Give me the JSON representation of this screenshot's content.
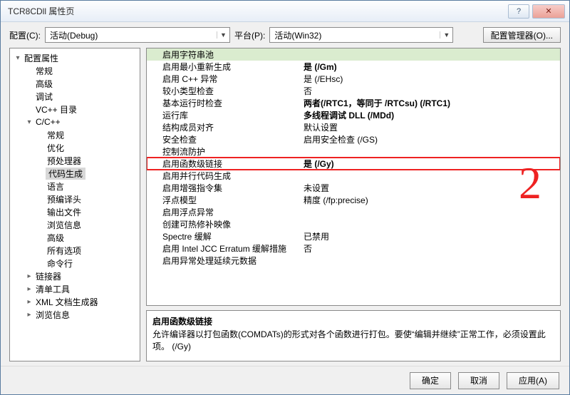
{
  "window": {
    "title": "TCR8CDll 属性页"
  },
  "toprow": {
    "config_label": "配置(C):",
    "config_value": "活动(Debug)",
    "platform_label": "平台(P):",
    "platform_value": "活动(Win32)",
    "config_mgr": "配置管理器(O)..."
  },
  "tree": [
    {
      "d": 0,
      "t": "▾",
      "l": "配置属性"
    },
    {
      "d": 1,
      "t": "",
      "l": "常规"
    },
    {
      "d": 1,
      "t": "",
      "l": "高级"
    },
    {
      "d": 1,
      "t": "",
      "l": "调试"
    },
    {
      "d": 1,
      "t": "",
      "l": "VC++ 目录"
    },
    {
      "d": 1,
      "t": "▾",
      "l": "C/C++"
    },
    {
      "d": 2,
      "t": "",
      "l": "常规"
    },
    {
      "d": 2,
      "t": "",
      "l": "优化"
    },
    {
      "d": 2,
      "t": "",
      "l": "预处理器"
    },
    {
      "d": 2,
      "t": "",
      "l": "代码生成",
      "sel": true
    },
    {
      "d": 2,
      "t": "",
      "l": "语言"
    },
    {
      "d": 2,
      "t": "",
      "l": "预编译头"
    },
    {
      "d": 2,
      "t": "",
      "l": "输出文件"
    },
    {
      "d": 2,
      "t": "",
      "l": "浏览信息"
    },
    {
      "d": 2,
      "t": "",
      "l": "高级"
    },
    {
      "d": 2,
      "t": "",
      "l": "所有选项"
    },
    {
      "d": 2,
      "t": "",
      "l": "命令行"
    },
    {
      "d": 1,
      "t": "▸",
      "l": "链接器"
    },
    {
      "d": 1,
      "t": "▸",
      "l": "清单工具"
    },
    {
      "d": 1,
      "t": "▸",
      "l": "XML 文档生成器"
    },
    {
      "d": 1,
      "t": "▸",
      "l": "浏览信息"
    }
  ],
  "grid": [
    {
      "hdr": true,
      "k": "启用字符串池",
      "v": ""
    },
    {
      "k": "启用最小重新生成",
      "v": "是 (/Gm)",
      "bold": true
    },
    {
      "k": "启用 C++ 异常",
      "v": "是 (/EHsc)"
    },
    {
      "k": "较小类型检查",
      "v": "否"
    },
    {
      "k": "基本运行时检查",
      "v": "两者(/RTC1，等同于 /RTCsu) (/RTC1)",
      "bold": true
    },
    {
      "k": "运行库",
      "v": "多线程调试 DLL (/MDd)",
      "bold": true
    },
    {
      "k": "结构成员对齐",
      "v": "默认设置"
    },
    {
      "k": "安全检查",
      "v": "启用安全检查 (/GS)"
    },
    {
      "k": "控制流防护",
      "v": ""
    },
    {
      "hl": true,
      "k": "启用函数级链接",
      "v": "是 (/Gy)",
      "bold": true
    },
    {
      "k": "启用并行代码生成",
      "v": ""
    },
    {
      "k": "启用增强指令集",
      "v": "未设置"
    },
    {
      "k": "浮点模型",
      "v": "精度 (/fp:precise)"
    },
    {
      "k": "启用浮点异常",
      "v": ""
    },
    {
      "k": "创建可热修补映像",
      "v": ""
    },
    {
      "k": "Spectre 缓解",
      "v": "已禁用"
    },
    {
      "k": "启用 Intel JCC Erratum 缓解措施",
      "v": "否"
    },
    {
      "k": "启用异常处理延续元数据",
      "v": ""
    }
  ],
  "annotation": {
    "number": "2"
  },
  "desc": {
    "title": "启用函数级链接",
    "body": "允许编译器以打包函数(COMDATs)的形式对各个函数进行打包。要使“编辑并继续”正常工作，必须设置此项。     (/Gy)"
  },
  "footer": {
    "ok": "确定",
    "cancel": "取消",
    "apply": "应用(A)"
  }
}
